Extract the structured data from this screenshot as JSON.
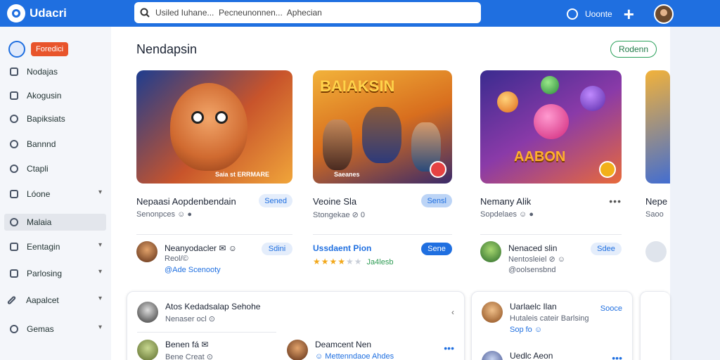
{
  "app": {
    "name": "Udacri"
  },
  "search": {
    "value": "Usiled Iuhane...  Pecneunonnen...  Aphecian",
    "placeholder": "Search"
  },
  "topbar": {
    "account_label": "Uoonte"
  },
  "sidebar": {
    "badge": "Foredici",
    "items": [
      {
        "label": "Nodajas",
        "chevron": false
      },
      {
        "label": "Akogusin",
        "chevron": false
      },
      {
        "label": "Bapiksiats",
        "chevron": false
      },
      {
        "label": "Bannnd",
        "chevron": false
      },
      {
        "label": "Ctapli",
        "chevron": false
      },
      {
        "label": "Lóone",
        "chevron": true
      },
      {
        "label": "Malaia",
        "chevron": false
      },
      {
        "label": "Eentagin",
        "chevron": true
      },
      {
        "label": "Parlosing",
        "chevron": true
      },
      {
        "label": "Aapalcet",
        "chevron": true
      },
      {
        "label": "Gemas",
        "chevron": true
      }
    ]
  },
  "main": {
    "title": "Nendapsin",
    "header_button": "Rodenn",
    "cards": [
      {
        "thumb_text": "",
        "thumb_foot": "Saia st ERRMARE",
        "title": "Nepaasi Aopdenbendain",
        "sub": "Senonpces ☺ ●",
        "pill": "Sened",
        "row": {
          "name": "Neanyodacler ✉ ☺",
          "sub": "Reol/©",
          "line3": "@Ade Scenooty",
          "pill": "Sdini"
        }
      },
      {
        "thumb_text": "BAIAKSIN",
        "thumb_foot": "Saeanes",
        "title": "Veoine Sla",
        "sub": "Stongekae ⊘ 0",
        "pill": "Sensl",
        "row": {
          "name": "Ussdaent Pion",
          "pill": "Sene",
          "rating": "Ja4lesb"
        }
      },
      {
        "thumb_text": "AABON",
        "thumb_foot": "",
        "title": "Nemany Alik",
        "sub": "Sopdelaes ☺ ●",
        "pill": "•••",
        "row": {
          "name": "Nenaced slin",
          "sub": "Nentosleiel ⊘ ☺",
          "line3": "@oolsensbnd",
          "pill": "Sdee"
        }
      },
      {
        "thumb_text": "",
        "thumb_foot": "",
        "title": "Nepe",
        "sub": "Saoo",
        "pill": "",
        "row": {
          "name": "",
          "sub": "",
          "line3": "",
          "pill": ""
        }
      }
    ],
    "panel_left": [
      {
        "name": "Atos Kedadsalap Sehohe",
        "sub": "Nenaser ocl ⊙",
        "right": "‹"
      },
      {
        "name": "Benen fá ✉",
        "sub": "Bene Creat ⊙"
      },
      {
        "name": "Deamcent Nen",
        "sub": "☺ Mettenndaoe Ahdes",
        "right": "•••"
      }
    ],
    "panel_right": [
      {
        "name": "Uarlaelc Ilan",
        "sub": "Hutaleis cateir Barlsing",
        "line3": "Sop fo ☺",
        "right": "Sooce"
      },
      {
        "name": "Uedlc Aeon",
        "sub": "",
        "right": "•••"
      }
    ]
  },
  "colors": {
    "brand": "#1f6fe0",
    "accent": "#e8542b",
    "success": "#2aa05a"
  }
}
